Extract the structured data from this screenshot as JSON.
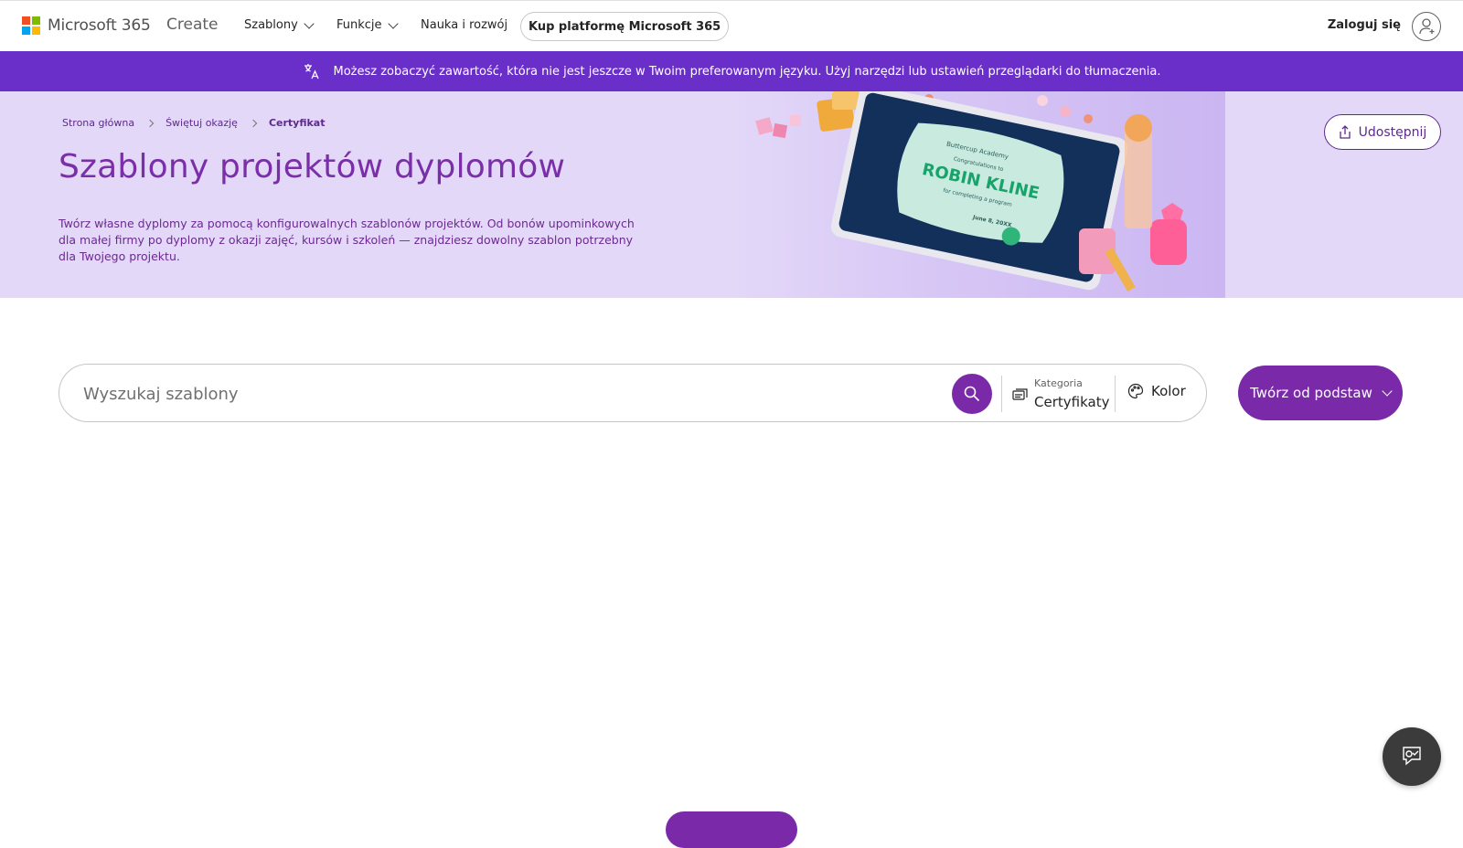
{
  "brand": {
    "name": "Microsoft 365",
    "logo_colors": [
      "#f25022",
      "#7fba00",
      "#00a4ef",
      "#ffb900"
    ]
  },
  "nav": {
    "create": "Create",
    "items": [
      {
        "label": "Szablony",
        "icon": "chevron-down-icon"
      },
      {
        "label": "Funkcje",
        "icon": "chevron-down-icon"
      },
      {
        "label": "Nauka i rozwój"
      }
    ],
    "buy_label": "Kup platformę Microsoft 365",
    "signin_label": "Zaloguj się",
    "avatar_icon": "user-add-icon"
  },
  "language_banner": {
    "icon": "translate-icon",
    "text": "Możesz zobaczyć zawartość, która nie jest jeszcze w Twoim preferowanym języku. Użyj narzędzi lub ustawień przeglądarki do tłumaczenia."
  },
  "hero": {
    "breadcrumb": [
      "Strona główna",
      "Świętuj okazję",
      "Certyfikat"
    ],
    "title": "Szablony projektów dyplomów",
    "description": "Twórz własne dyplomy za pomocą konfigurowalnych szablonów projektów. Od bonów upominkowych dla małej firmy po dyplomy z okazji zajęć, kursów i szkoleń — znajdziesz dowolny szablon potrzebny dla Twojego projektu.",
    "share_label": "Udostępnij",
    "art": {
      "academy": "Buttercup Academy",
      "congrats": "Congratulations to",
      "name": "ROBIN KLINE",
      "sub": "for completing a program",
      "date": "June 8, 20XX"
    }
  },
  "search": {
    "placeholder": "Wyszukaj szablony",
    "category_label": "Kategoria",
    "category_value": "Certyfikaty",
    "color_label": "Kolor"
  },
  "create_button": "Twórz od podstaw",
  "colors": {
    "accent": "#7a2aa8",
    "banner": "#6b2fc9",
    "hero_bg": "#e3d8f8"
  }
}
